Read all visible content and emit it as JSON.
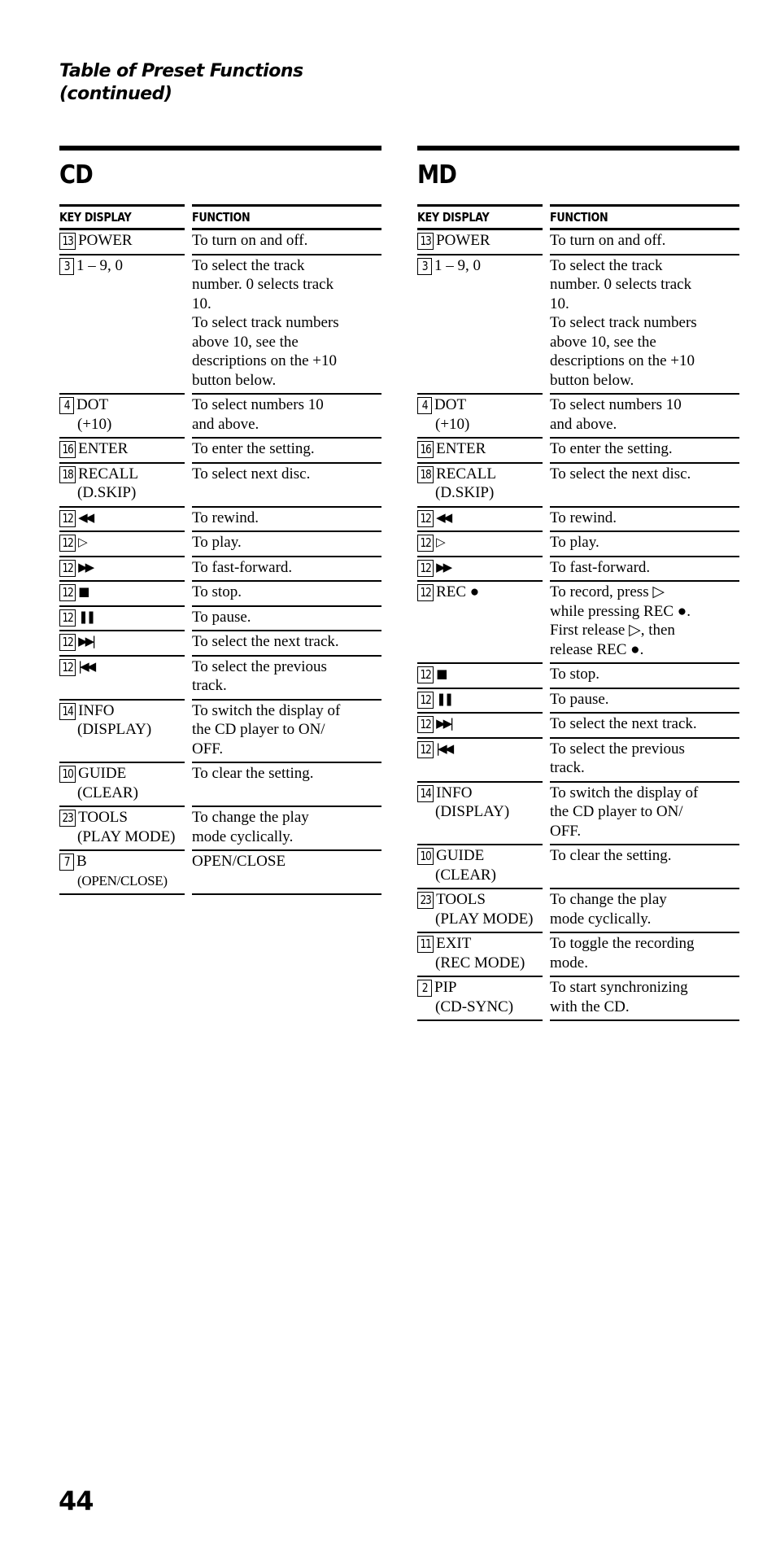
{
  "page": {
    "title_line1": "Table of Preset Functions",
    "title_line2": "(continued)",
    "page_number": "44"
  },
  "sections": [
    {
      "id": "cd",
      "title": "CD",
      "headers": {
        "key": "KEY DISPLAY",
        "function": "FUNCTION"
      },
      "rows": [
        {
          "num": "13",
          "key": "POWER",
          "key_sub": "",
          "function": "To turn on and off."
        },
        {
          "num": "3",
          "key": "1 – 9, 0",
          "key_sub": "",
          "function": "To select the track\nnumber. 0 selects track\n10.\nTo select track numbers\nabove 10, see the\ndescriptions on the +10\nbutton below."
        },
        {
          "num": "4",
          "key": "DOT",
          "key_sub": "(+10)",
          "function": "To select numbers 10\nand above."
        },
        {
          "num": "16",
          "key": "ENTER",
          "key_sub": "",
          "function": "To enter the setting."
        },
        {
          "num": "18",
          "key": "RECALL",
          "key_sub": "(D.SKIP)",
          "function": "To select next disc.\n "
        },
        {
          "num": "12",
          "key": "◀◀",
          "icon": "rewind-icon",
          "key_sub": "",
          "function": "To rewind."
        },
        {
          "num": "12",
          "key": "▷",
          "icon": "play-icon",
          "key_sub": "",
          "function": "To play."
        },
        {
          "num": "12",
          "key": "▶▶",
          "icon": "fast-forward-icon",
          "key_sub": "",
          "function": "To fast-forward."
        },
        {
          "num": "12",
          "key": "■",
          "icon": "stop-icon",
          "key_sub": "",
          "function": "To stop."
        },
        {
          "num": "12",
          "key": "❚❚",
          "icon": "pause-icon",
          "key_sub": "",
          "function": "To pause."
        },
        {
          "num": "12",
          "key": "▶▶|",
          "icon": "next-track-icon",
          "key_sub": "",
          "function": "To select the next track."
        },
        {
          "num": "12",
          "key": "|◀◀",
          "icon": "previous-track-icon",
          "key_sub": "",
          "function": "To select the previous\ntrack."
        },
        {
          "num": "14",
          "key": "INFO",
          "key_sub": "(DISPLAY)",
          "function": "To switch the display of\nthe CD player to ON/\nOFF."
        },
        {
          "num": "10",
          "key": "GUIDE",
          "key_sub": "(CLEAR)",
          "function": "To clear the setting.\n "
        },
        {
          "num": "23",
          "key": "TOOLS",
          "key_sub": "(PLAY MODE)",
          "function": "To change the play\nmode cyclically."
        },
        {
          "num": "7",
          "key": "B",
          "key_sub": "(OPEN/CLOSE)",
          "key_sub_small": true,
          "function": "OPEN/CLOSE\n "
        }
      ]
    },
    {
      "id": "md",
      "title": "MD",
      "headers": {
        "key": "KEY DISPLAY",
        "function": "FUNCTION"
      },
      "rows": [
        {
          "num": "13",
          "key": "POWER",
          "key_sub": "",
          "function": "To turn on and off."
        },
        {
          "num": "3",
          "key": "1 – 9, 0",
          "key_sub": "",
          "function": "To select the track\nnumber. 0 selects track\n10.\nTo select track numbers\nabove 10, see the\ndescriptions on the +10\nbutton below."
        },
        {
          "num": "4",
          "key": "DOT",
          "key_sub": "(+10)",
          "function": "To select numbers 10\nand above."
        },
        {
          "num": "16",
          "key": "ENTER",
          "key_sub": "",
          "function": "To enter the setting."
        },
        {
          "num": "18",
          "key": "RECALL",
          "key_sub": "(D.SKIP)",
          "function": "To select the next disc.\n "
        },
        {
          "num": "12",
          "key": "◀◀",
          "icon": "rewind-icon",
          "key_sub": "",
          "function": "To rewind."
        },
        {
          "num": "12",
          "key": "▷",
          "icon": "play-icon",
          "key_sub": "",
          "function": "To play."
        },
        {
          "num": "12",
          "key": "▶▶",
          "icon": "fast-forward-icon",
          "key_sub": "",
          "function": "To fast-forward."
        },
        {
          "num": "12",
          "key": "REC ●",
          "key_sub": "",
          "function": "To record, press ▷\nwhile pressing REC ●.\nFirst release ▷, then\nrelease REC ●."
        },
        {
          "num": "12",
          "key": "■",
          "icon": "stop-icon",
          "key_sub": "",
          "function": "To stop."
        },
        {
          "num": "12",
          "key": "❚❚",
          "icon": "pause-icon",
          "key_sub": "",
          "function": "To pause."
        },
        {
          "num": "12",
          "key": "▶▶|",
          "icon": "next-track-icon",
          "key_sub": "",
          "function": "To select the next track."
        },
        {
          "num": "12",
          "key": "|◀◀",
          "icon": "previous-track-icon",
          "key_sub": "",
          "function": "To select the previous\ntrack."
        },
        {
          "num": "14",
          "key": "INFO",
          "key_sub": "(DISPLAY)",
          "function": "To switch the display of\nthe CD player to ON/\nOFF."
        },
        {
          "num": "10",
          "key": "GUIDE",
          "key_sub": "(CLEAR)",
          "function": "To clear the setting.\n "
        },
        {
          "num": "23",
          "key": "TOOLS",
          "key_sub": "(PLAY MODE)",
          "function": "To change the play\nmode cyclically."
        },
        {
          "num": "11",
          "key": "EXIT",
          "key_sub": "(REC MODE)",
          "function": "To toggle the recording\nmode."
        },
        {
          "num": "2",
          "key": "PIP",
          "key_sub": "(CD-SYNC)",
          "function": "To start synchronizing\nwith the CD."
        }
      ]
    }
  ]
}
